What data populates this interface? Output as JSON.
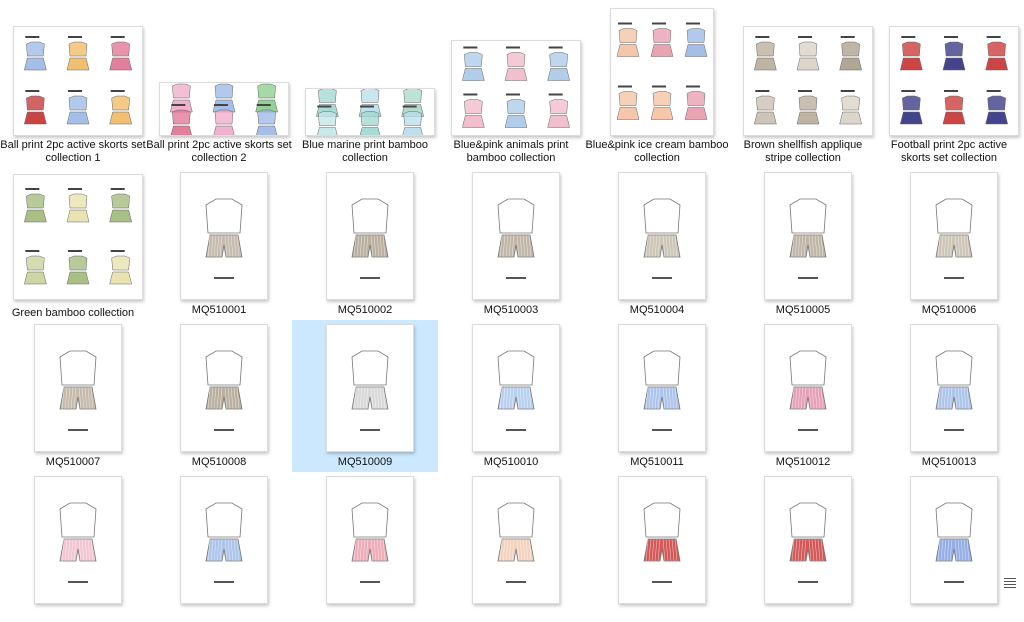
{
  "tiles": [
    {
      "label": "Ball print 2pc active skorts set collection 1",
      "kind": "collection",
      "palette": [
        "#9ab7e6",
        "#f0b860",
        "#e07090",
        "#c43030"
      ]
    },
    {
      "label": "Ball print 2pc active skorts set collection 2",
      "kind": "collection",
      "palette": [
        "#f0a8c8",
        "#9ab7e6",
        "#88cc88",
        "#e07090"
      ]
    },
    {
      "label": "Blue marine print bamboo collection",
      "kind": "collection",
      "palette": [
        "#9fd7d0",
        "#b7dde8",
        "#a8d8c8",
        "#c4e4ea"
      ]
    },
    {
      "label": "Blue&pink animals print bamboo collection",
      "kind": "collection",
      "palette": [
        "#a8c8e8",
        "#f0b8c8",
        "#a8c8e8",
        "#f0b8c8"
      ]
    },
    {
      "label": "Blue&pink ice cream bamboo collection",
      "kind": "collection",
      "palette": [
        "#f4c0a0",
        "#e89aa8",
        "#9ab7e6",
        "#f4c0a0"
      ]
    },
    {
      "label": "Brown shellfish applique stripe collection",
      "kind": "collection",
      "palette": [
        "#b8ab98",
        "#d8d0c4",
        "#a89c88",
        "#c8beb0"
      ]
    },
    {
      "label": "Football print 2pc active skorts set collection",
      "kind": "collection",
      "palette": [
        "#c83030",
        "#303080",
        "#c83030",
        "#303080"
      ]
    },
    {
      "label": "Green bamboo collection",
      "kind": "collection",
      "palette": [
        "#a0b878",
        "#e8e0a8",
        "#a0b878",
        "#c8d098"
      ]
    },
    {
      "label": "MQ510001",
      "kind": "product",
      "accent": "#b8ab98"
    },
    {
      "label": "MQ510002",
      "kind": "product",
      "accent": "#a89c88"
    },
    {
      "label": "MQ510003",
      "kind": "product",
      "accent": "#b0a492"
    },
    {
      "label": "MQ510004",
      "kind": "product",
      "accent": "#c0b6a4"
    },
    {
      "label": "MQ510005",
      "kind": "product",
      "accent": "#b0a492"
    },
    {
      "label": "MQ510006",
      "kind": "product",
      "accent": "#c0b6a4"
    },
    {
      "label": "MQ510007",
      "kind": "product",
      "accent": "#b8ab98"
    },
    {
      "label": "MQ510008",
      "kind": "product",
      "accent": "#a89c88"
    },
    {
      "label": "MQ510009",
      "kind": "product",
      "accent": "#d0d0d0"
    },
    {
      "label": "MQ510010",
      "kind": "product",
      "accent": "#a8c4ec"
    },
    {
      "label": "MQ510011",
      "kind": "product",
      "accent": "#9ab7e6"
    },
    {
      "label": "MQ510012",
      "kind": "product",
      "accent": "#e08aa8"
    },
    {
      "label": "MQ510013",
      "kind": "product",
      "accent": "#9ab7e6"
    },
    {
      "label": "",
      "kind": "product",
      "accent": "#f0b8c8"
    },
    {
      "label": "",
      "kind": "product",
      "accent": "#9ab7e6"
    },
    {
      "label": "",
      "kind": "product",
      "accent": "#e89aa8"
    },
    {
      "label": "",
      "kind": "product",
      "accent": "#f0c8b0"
    },
    {
      "label": "",
      "kind": "product",
      "accent": "#c83030"
    },
    {
      "label": "",
      "kind": "product",
      "accent": "#c83030"
    },
    {
      "label": "",
      "kind": "product",
      "accent": "#7a9ae0"
    }
  ],
  "selected_label": "MQ510009",
  "menu_icon": "hamburger-icon"
}
